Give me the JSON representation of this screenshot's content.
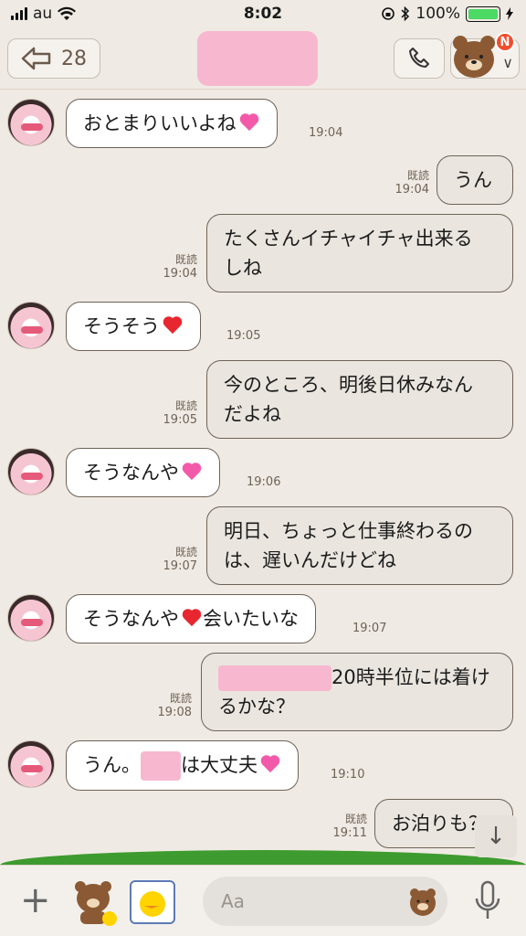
{
  "status_bar": {
    "carrier": "au",
    "time": "8:02",
    "battery": "100%"
  },
  "header": {
    "unread_count": "28",
    "notification_badge": "N"
  },
  "messages": [
    {
      "side": "in",
      "text": "おとまりいいよね",
      "time": "19:04"
    },
    {
      "side": "out",
      "text": "うん",
      "read": "既読",
      "time": "19:04"
    },
    {
      "side": "out",
      "line1": "たくさんイチャイチャ出来る",
      "line2": "しね",
      "read": "既読",
      "time": "19:04"
    },
    {
      "side": "in",
      "text": "そうそう",
      "time": "19:05"
    },
    {
      "side": "out",
      "line1": "今のところ、明後日休みなん",
      "line2": "だよね",
      "read": "既読",
      "time": "19:05"
    },
    {
      "side": "in",
      "text": "そうなんや",
      "time": "19:06"
    },
    {
      "side": "out",
      "line1": "明日、ちょっと仕事終わるの",
      "line2": "は、遅いんだけどね",
      "read": "既読",
      "time": "19:07"
    },
    {
      "side": "in",
      "text_a": "そうなんや",
      "text_b": "会いたいな",
      "time": "19:07"
    },
    {
      "side": "out",
      "line1": "20時半位には着け",
      "line2": "るかな？",
      "read": "既読",
      "time": "19:08"
    },
    {
      "side": "in",
      "text_a": "うん。",
      "text_b": "は大丈夫",
      "time": "19:10"
    },
    {
      "side": "out",
      "text": "お泊りも？",
      "read": "既読",
      "time": "19:11"
    }
  ],
  "input": {
    "placeholder": "Aa"
  },
  "icons": {
    "back": "back-arrow-icon",
    "call": "phone-icon",
    "menu": "chevron-down-icon",
    "add": "plus-icon",
    "mic": "microphone-icon",
    "scroll": "arrow-down-icon"
  }
}
